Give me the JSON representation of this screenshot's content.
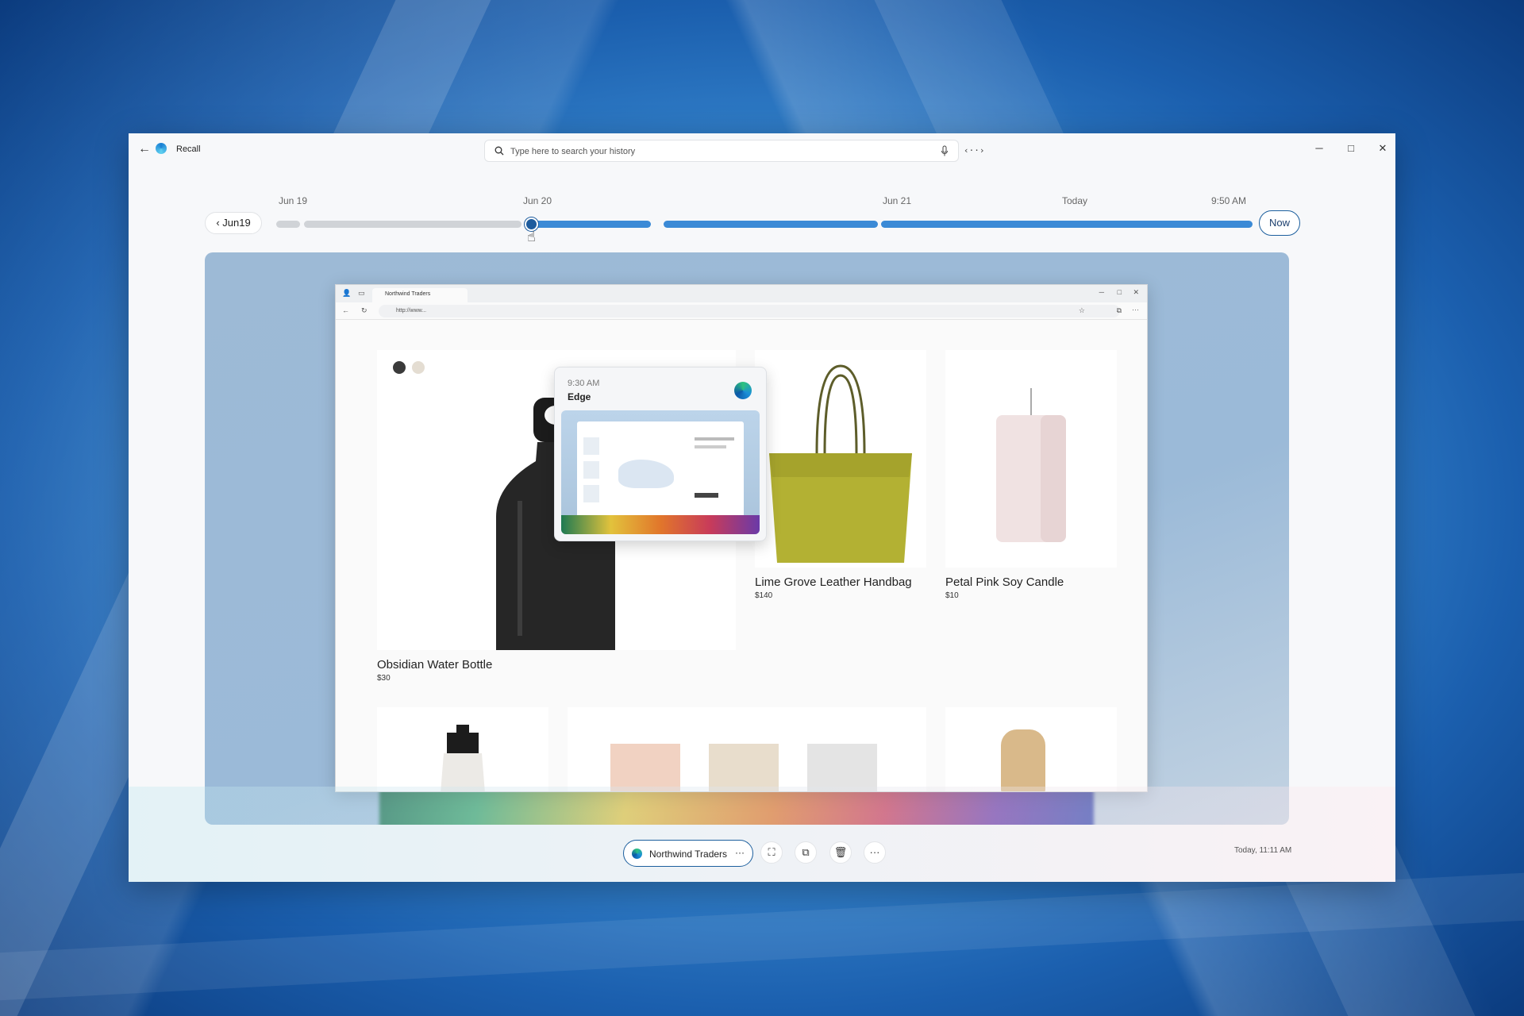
{
  "app": {
    "title": "Recall"
  },
  "search": {
    "placeholder": "Type here to search your history",
    "more_label": "‹··›"
  },
  "window_controls": {
    "minimize": "─",
    "maximize": "□",
    "close": "✕"
  },
  "timeline": {
    "labels": [
      "Jun 19",
      "Jun 20",
      "Jun 21",
      "Today",
      "9:50 AM"
    ],
    "prev_button": "Jun19",
    "now_button": "Now"
  },
  "popup": {
    "time": "9:30 AM",
    "app": "Edge"
  },
  "browser": {
    "tab_title": "Northwind Traders",
    "address": "http://www..."
  },
  "products": [
    {
      "name": "Obsidian  Water Bottle",
      "price": "$30"
    },
    {
      "name": "Lime Grove Leather Handbag",
      "price": "$140"
    },
    {
      "name": "Petal Pink Soy Candle",
      "price": "$10"
    }
  ],
  "bottom": {
    "site_label": "Northwind Traders",
    "site_more": "···",
    "timestamp": "Today, 11:11 AM"
  },
  "icons": [
    "back-arrow-icon",
    "recall-logo-icon",
    "search-icon",
    "microphone-icon",
    "edge-logo-icon",
    "screenshot-icon",
    "copy-icon",
    "delete-icon",
    "more-icon"
  ],
  "colors": {
    "accent": "#1e5c9e",
    "timeline_active": "#3b8ad6",
    "timeline_inactive": "#d0d3d7"
  }
}
